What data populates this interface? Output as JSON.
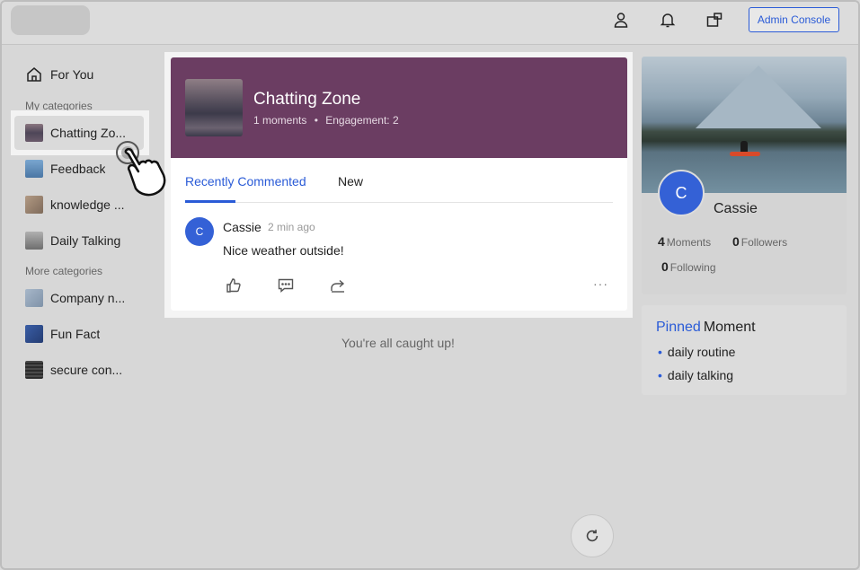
{
  "header": {
    "admin_label": "Admin Console",
    "icons": [
      "user-icon",
      "bell-icon",
      "switch-icon"
    ]
  },
  "sidebar": {
    "for_you": "For You",
    "my_categories_heading": "My categories",
    "more_categories_heading": "More categories",
    "my_categories": [
      {
        "label": "Chatting Zo...",
        "color": "#6a5a6a",
        "selected": true
      },
      {
        "label": "Feedback",
        "color": "#5d88b4"
      },
      {
        "label": "knowledge ...",
        "color": "#9a8470"
      },
      {
        "label": "Daily Talking",
        "color": "#8d8d8d"
      }
    ],
    "more_categories": [
      {
        "label": "Company n...",
        "color": "#8fa2b8"
      },
      {
        "label": "Fun Fact",
        "color": "#2f4f8e"
      },
      {
        "label": "secure con...",
        "color": "#3a3a3a"
      }
    ]
  },
  "category": {
    "title": "Chatting Zone",
    "moments": "1 moments",
    "separator": "•",
    "engagement": "Engagement: 2",
    "banner_color": "#6b3d62"
  },
  "tabs": [
    {
      "label": "Recently Commented",
      "active": true
    },
    {
      "label": "New",
      "active": false
    }
  ],
  "post": {
    "avatar_letter": "C",
    "author": "Cassie",
    "time": "2 min ago",
    "text": "Nice weather outside!",
    "actions": [
      "like-icon",
      "comment-icon",
      "share-icon"
    ],
    "more": "···"
  },
  "feed_end": "You're all caught up!",
  "profile": {
    "avatar_letter": "C",
    "name": "Cassie",
    "moments_count": "4",
    "moments_label": "Moments",
    "followers_count": "0",
    "followers_label": "Followers",
    "following_count": "0",
    "following_label": "Following"
  },
  "pinned": {
    "title_blue": "Pinned",
    "title_rest": "Moment",
    "items": [
      "daily routine",
      "daily talking"
    ]
  },
  "colors": {
    "accent": "#2a5bd7",
    "avatar": "#3461d6"
  }
}
